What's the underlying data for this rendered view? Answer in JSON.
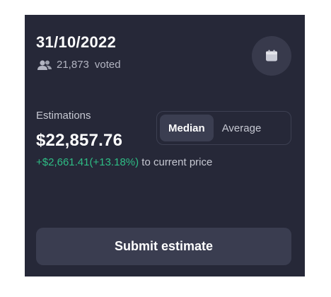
{
  "header": {
    "date": "31/10/2022",
    "voted_count": "21,873",
    "voted_label": "voted",
    "users_icon": "users-icon",
    "calendar_icon": "calendar-icon"
  },
  "estimations": {
    "label": "Estimations",
    "value": "$22,857.76",
    "change": "+$2,661.41(+13.18%)",
    "change_suffix": "to current price"
  },
  "toggle": {
    "options": [
      "Median",
      "Average"
    ],
    "selected": "Median"
  },
  "actions": {
    "submit_label": "Submit estimate"
  },
  "colors": {
    "card_bg": "#262838",
    "positive": "#2ebd85",
    "muted_text": "#b3b5c2"
  }
}
